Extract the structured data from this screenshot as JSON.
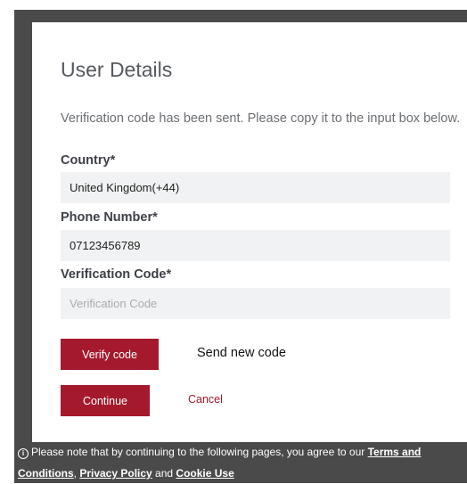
{
  "form": {
    "title": "User Details",
    "info_text": "Verification code has been sent. Please copy it to the input box below.",
    "country": {
      "label": "Country*",
      "value": "United Kingdom(+44)"
    },
    "phone": {
      "label": "Phone Number*",
      "value": "07123456789"
    },
    "verification": {
      "label": "Verification Code*",
      "value": "",
      "placeholder": "Verification Code"
    },
    "verify_button": "Verify code",
    "send_new_code": "Send new code",
    "continue_button": "Continue",
    "cancel_link": "Cancel"
  },
  "footer": {
    "icon": "info-icon",
    "text_before": "Please note that by continuing to the following pages, you agree to our ",
    "terms": "Terms and Conditions",
    "sep1": ", ",
    "privacy": "Privacy Policy",
    "sep2": " and ",
    "cookie": "Cookie Use"
  },
  "colors": {
    "accent": "#a5192d",
    "frame": "#4a4a4a",
    "field_bg": "#f1f2f3"
  }
}
